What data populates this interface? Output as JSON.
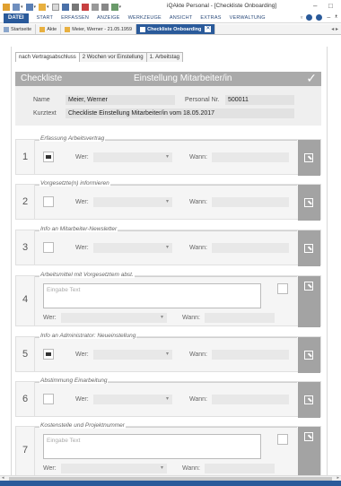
{
  "window": {
    "title": "iQAkte Personal - [Checkliste Onboarding]",
    "minimize": "–",
    "maximize": "□"
  },
  "ribbon": {
    "file": "DATEI",
    "items": [
      "START",
      "ERFASSEN",
      "ANZEIGE",
      "WERKZEUGE",
      "ANSICHT",
      "EXTRAS",
      "VERWALTUNG"
    ]
  },
  "doc_tabs": [
    {
      "label": "Startseite"
    },
    {
      "label": "Akte"
    },
    {
      "label": "Meier, Werner - 21.05.1959"
    },
    {
      "label": "Checkliste Onboarding"
    }
  ],
  "wizard_tabs": [
    "nach Vertragsabschluss",
    "2 Wochen vor Einstellung",
    "1. Arbeitstag"
  ],
  "header": {
    "left": "Checkliste",
    "center": "Einstellung Mitarbeiter/in",
    "check": "✓"
  },
  "info": {
    "name_label": "Name",
    "name_value": "Meier, Werner",
    "pnr_label": "Personal Nr.",
    "pnr_value": "500011",
    "kurz_label": "Kurztext",
    "kurz_value": "Checkliste Einstellung Mitarbeiter/in vom 18.05.2017"
  },
  "labels": {
    "wer": "Wer:",
    "wann": "Wann:",
    "placeholder": "Eingabe Text"
  },
  "steps": [
    {
      "num": "1",
      "title": "Erfassung Arbeitsvertrag",
      "checked": true
    },
    {
      "num": "2",
      "title": "Vorgesetzte(n) informieren",
      "checked": false
    },
    {
      "num": "3",
      "title": "Info an Mitarbeiter-Newsletter",
      "checked": false
    },
    {
      "num": "4",
      "title": "Arbeitsmittel mit Vorgesetztem abst.",
      "checked": false
    },
    {
      "num": "5",
      "title": "Info an Administrator: Neueinstellung",
      "checked": true
    },
    {
      "num": "6",
      "title": "Abstimmung Einarbeitung",
      "checked": false
    },
    {
      "num": "7",
      "title": "Kostenstelle und Projektnummer",
      "checked": false
    }
  ],
  "colors": {
    "accent": "#2a5a9a",
    "header": "#aaaaaa",
    "action": "#a3a3a3"
  }
}
